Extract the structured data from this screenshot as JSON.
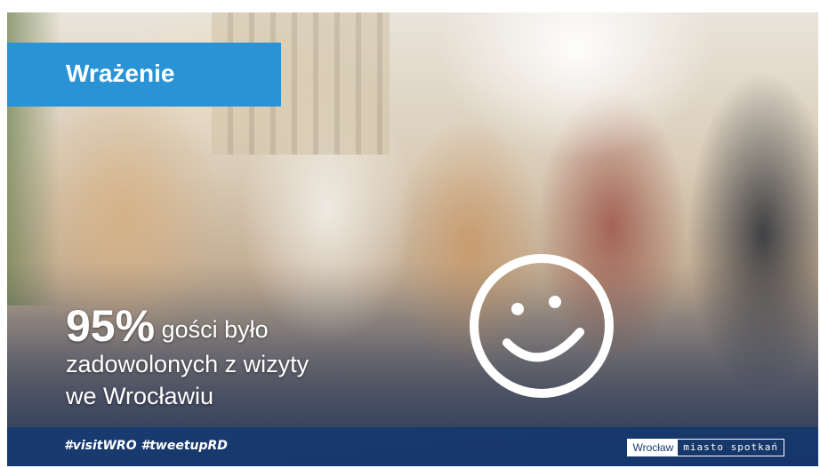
{
  "title": "Wrażenie",
  "stat": {
    "percent": "95%",
    "line1_rest": " gości było",
    "line2": "zadowolonych z wizyty",
    "line3": "we Wrocławiu"
  },
  "footer": {
    "hashtags": "#visitWRO #tweetupRD",
    "brand_city": "Wrocław",
    "brand_tagline": "miasto spotkań"
  },
  "icons": {
    "smiley": "smiley-face-icon"
  },
  "colors": {
    "title_bg": "#2a93d5",
    "footer_bg": "#173a70",
    "text": "#ffffff"
  }
}
